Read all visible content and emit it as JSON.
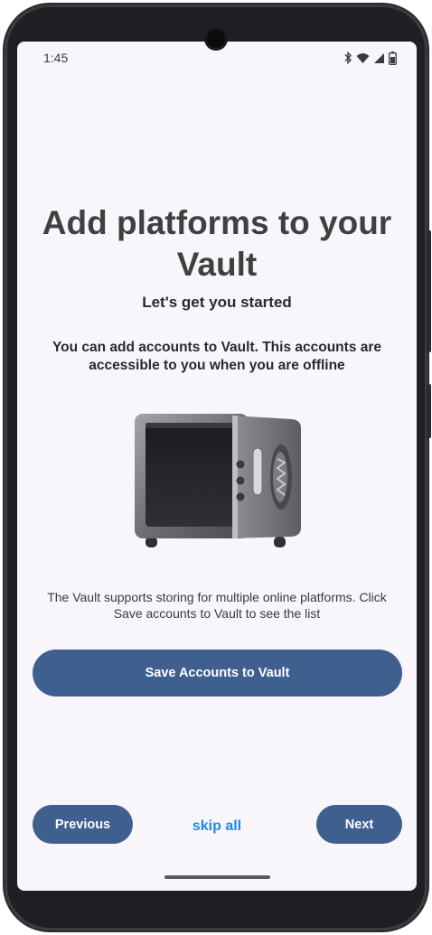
{
  "status_bar": {
    "time": "1:45",
    "icons": [
      "bluetooth-icon",
      "wifi-icon",
      "cellular-signal-icon",
      "battery-icon"
    ]
  },
  "onboarding": {
    "title": "Add platforms to your Vault",
    "subtitle": "Let's get you started",
    "intro": "You can add accounts to Vault. This accounts are accessible to you when you are offline",
    "illustration": "safe-illustration",
    "info": "The Vault supports storing for multiple online platforms. Click Save accounts to Vault to see the list",
    "save_button_label": "Save Accounts to Vault"
  },
  "navigation": {
    "previous_label": "Previous",
    "skip_label": "skip all",
    "next_label": "Next"
  },
  "colors": {
    "primary_button": "#3f5f8f",
    "link": "#1e88e5",
    "screen_background": "#f8f6fb",
    "title_text": "#404040"
  }
}
